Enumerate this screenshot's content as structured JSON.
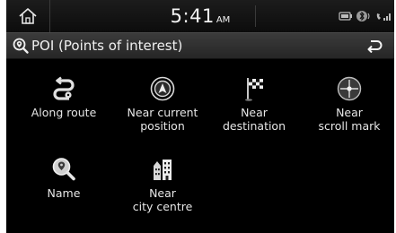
{
  "statusbar": {
    "time": "5:41",
    "ampm": "AM"
  },
  "header": {
    "title": "POI (Points of interest)"
  },
  "menu": {
    "items": [
      {
        "label": "Along route",
        "icon": "along-route-icon"
      },
      {
        "label": "Near current\nposition",
        "icon": "current-position-icon"
      },
      {
        "label": "Near\ndestination",
        "icon": "destination-flag-icon"
      },
      {
        "label": "Near\nscroll mark",
        "icon": "scroll-mark-icon"
      },
      {
        "label": "Name",
        "icon": "name-search-icon"
      },
      {
        "label": "Near\ncity centre",
        "icon": "city-centre-icon"
      }
    ]
  }
}
